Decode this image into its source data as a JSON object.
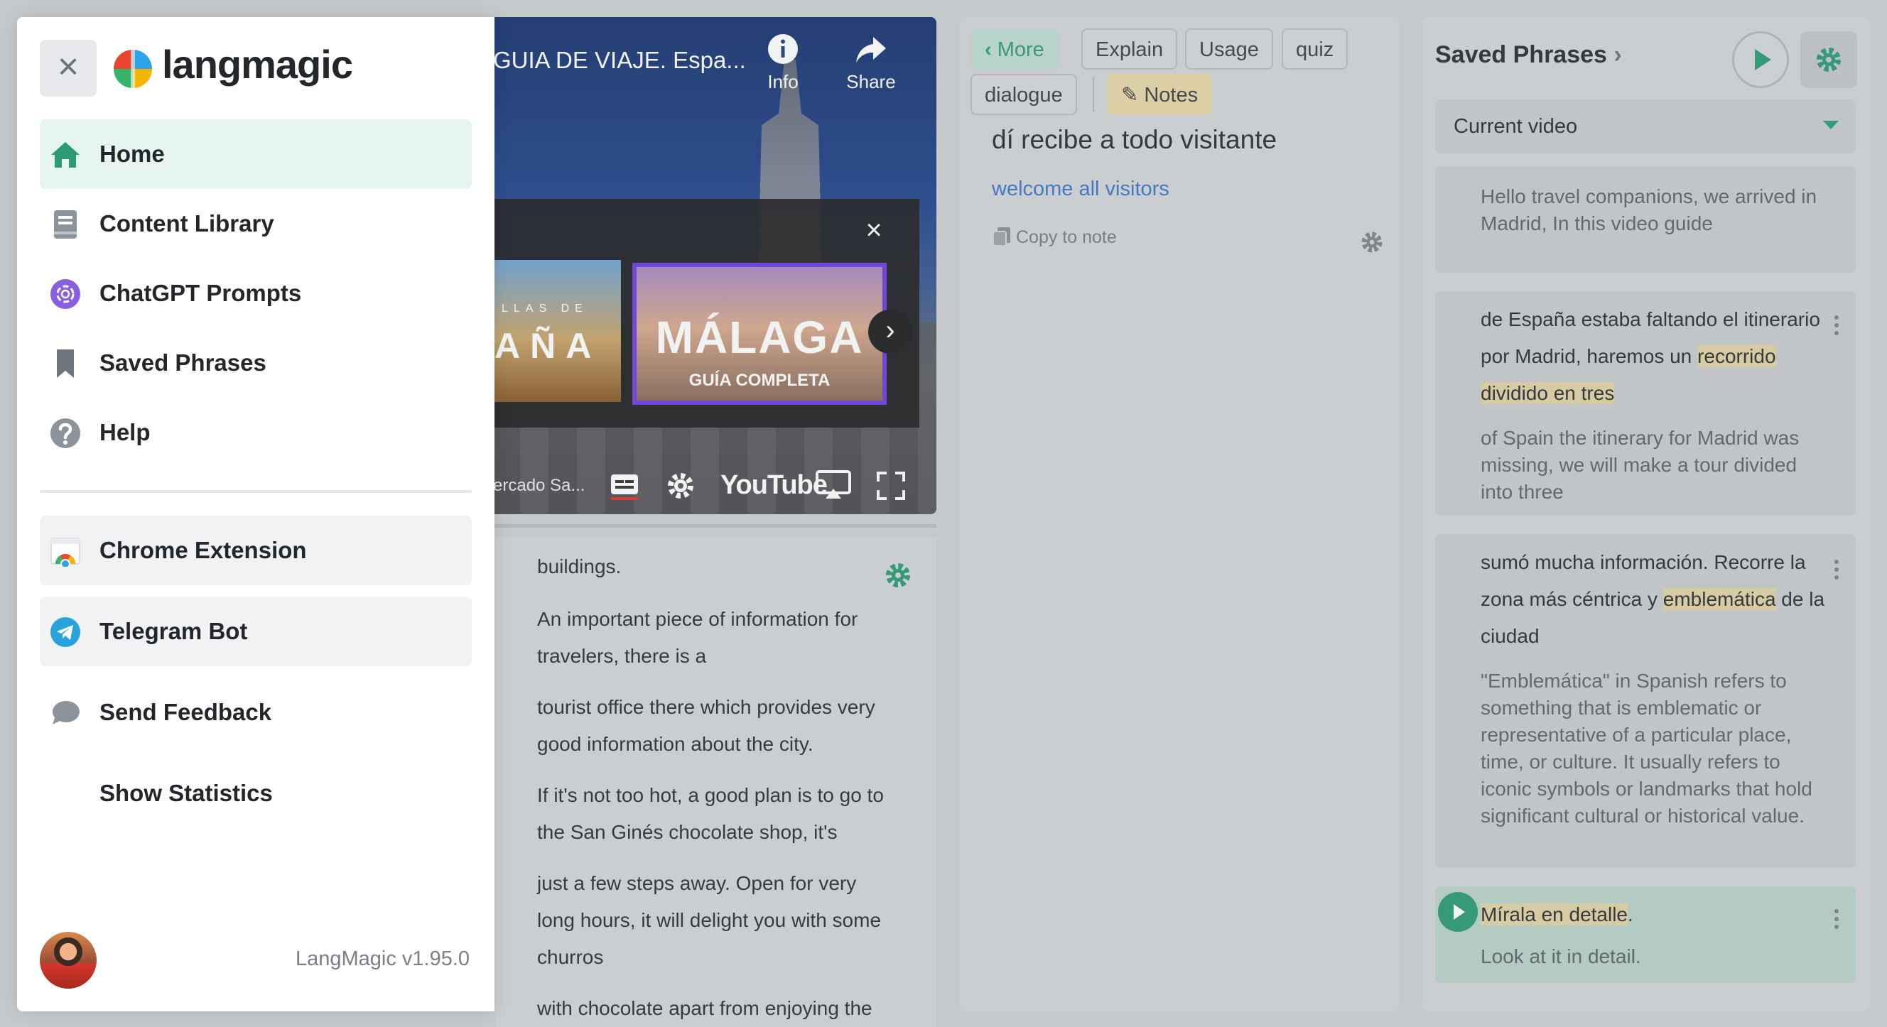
{
  "video": {
    "title": "GUIA DE VIAJE. Espa...",
    "info_label": "Info",
    "share_label": "Share",
    "endcard1_small": "LLAS DE",
    "endcard1_big": "AÑA",
    "endcard2_big": "MÁLAGA",
    "endcard2_small": "GUÍA COMPLETA",
    "chapter_text": "ercado Sa...",
    "youtube_label": "YouTube"
  },
  "transcript": [
    "buildings.",
    "An important piece of information for",
    "travelers, there is a",
    "tourist office there which provides very",
    "good information about the city.",
    "If it's not too hot, a good plan is to go to",
    "the San Ginés chocolate shop, it's",
    "just a few steps away. Open for very",
    "long hours, it will delight you with some",
    "churros",
    "with chocolate apart from enjoying the"
  ],
  "middle": {
    "chips": {
      "more": "More",
      "explain": "Explain",
      "usage": "Usage",
      "quiz": "quiz",
      "dialogue": "dialogue",
      "notes": "Notes"
    },
    "phrase_es": "dí recibe a todo visitante",
    "phrase_en": "welcome all visitors",
    "copy_to_note": "Copy to note"
  },
  "right": {
    "title": "Saved Phrases",
    "select_value": "Current video",
    "cards": [
      {
        "translation": "Hello travel companions, we arrived in Madrid, In this video guide"
      },
      {
        "es_before": "de España estaba faltando el itinerario por Madrid, haremos un ",
        "es_highlight": "recorrido dividido en tres",
        "translation": "of Spain the itinerary for Madrid was missing, we will make a tour divided into three"
      },
      {
        "es_before": "sumó mucha información. Recorre la zona más céntrica y ",
        "es_highlight": "emblemática",
        "es_after": " de la ciudad",
        "translation": "\"Emblemática\" in Spanish refers to something that is emblematic or representative of a particular place, time, or culture. It usually refers to iconic symbols or landmarks that hold significant cultural or historical value."
      },
      {
        "es_highlight": "Mírala en detalle",
        "es_after": ".",
        "translation": "Look at it in detail."
      }
    ]
  },
  "drawer": {
    "logo_text": "langmagic",
    "nav": {
      "home": "Home",
      "content_library": "Content Library",
      "chatgpt_prompts": "ChatGPT Prompts",
      "saved_phrases": "Saved Phrases",
      "help": "Help",
      "chrome_extension": "Chrome Extension",
      "telegram_bot": "Telegram Bot",
      "send_feedback": "Send Feedback",
      "show_statistics": "Show Statistics"
    },
    "version": "LangMagic v1.95.0"
  },
  "colors": {
    "accent": "#2a9a77",
    "link": "#3a76c8",
    "highlight": "#e2d3a6",
    "drawer_active": "#e7f5f1"
  }
}
